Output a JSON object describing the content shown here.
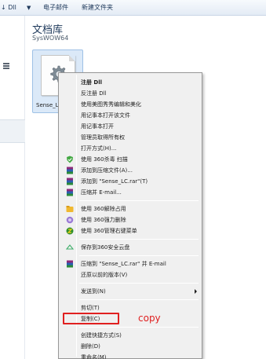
{
  "toolbar": {
    "library_prefix": "↓ Dll",
    "email_label": "电子邮件",
    "new_folder_label": "新建文件夹"
  },
  "library": {
    "title": "文档库",
    "subtitle": "SysWOW64"
  },
  "file": {
    "name": "Sense_L",
    "icon": "dll-gear-file-icon"
  },
  "context_menu": {
    "items": [
      {
        "label": "注册 Dll",
        "bold": true
      },
      {
        "label": "反注册 Dll"
      },
      {
        "label": "使用美图秀秀编辑和美化"
      },
      {
        "label": "用记事本打开该文件"
      },
      {
        "label": "用记事本打开"
      },
      {
        "label": "管理员取得所有权"
      },
      {
        "label": "打开方式(H)..."
      },
      {
        "label": "使用 360杀毒 扫描",
        "icon": "360-antivirus-icon"
      },
      {
        "label": "添加到压缩文件(A)...",
        "icon": "winrar-icon"
      },
      {
        "label": "添加到 \"Sense_LC.rar\"(T)",
        "icon": "winrar-icon"
      },
      {
        "label": "压缩并 E-mail...",
        "icon": "winrar-icon"
      },
      {
        "label": "使用 360解除占用",
        "icon": "360-unlock-icon"
      },
      {
        "label": "使用 360强力删除",
        "icon": "360-shred-icon"
      },
      {
        "label": "使用 360管理右键菜单",
        "icon": "360-menu-manager-icon"
      },
      {
        "label": "保存到360安全云盘",
        "icon": "360-cloud-icon"
      },
      {
        "label": "压缩到 \"Sense_LC.rar\" 并 E-mail",
        "icon": "winrar-icon"
      },
      {
        "label": "还原以前的版本(V)"
      },
      {
        "label": "发送到(N)",
        "has_submenu": true
      },
      {
        "label": "剪切(T)"
      },
      {
        "label": "复制(C)"
      },
      {
        "label": "创建快捷方式(S)"
      },
      {
        "label": "删除(D)"
      },
      {
        "label": "重命名(M)"
      }
    ]
  },
  "annotation": {
    "text": "copy",
    "color": "#e02020"
  }
}
